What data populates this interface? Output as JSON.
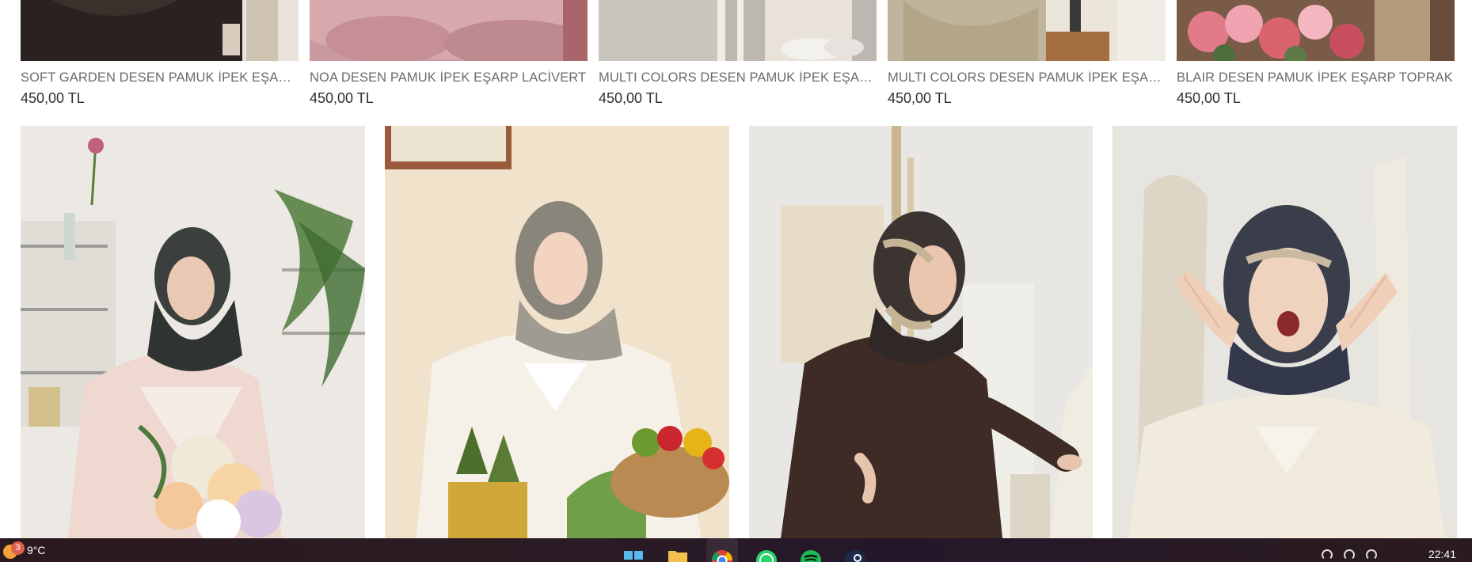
{
  "top_products": [
    {
      "name": "SOFT GARDEN DESEN PAMUK İPEK EŞARP...",
      "price": "450,00 TL"
    },
    {
      "name": "NOA DESEN PAMUK İPEK EŞARP LACİVERT",
      "price": "450,00 TL"
    },
    {
      "name": "MULTI COLORS DESEN PAMUK İPEK EŞARP...",
      "price": "450,00 TL"
    },
    {
      "name": "MULTI COLORS DESEN PAMUK İPEK EŞARP...",
      "price": "450,00 TL"
    },
    {
      "name": "BLAIR DESEN PAMUK İPEK EŞARP TOPRAK",
      "price": "450,00 TL"
    }
  ],
  "taskbar": {
    "weather_badge": "3",
    "temperature": "9°C",
    "apps": [
      "windows-start-icon",
      "file-explorer-icon",
      "chrome-icon",
      "whatsapp-icon",
      "spotify-icon",
      "steam-icon"
    ],
    "clock": "22:41"
  },
  "colors": {
    "text_muted": "#6b6b6b",
    "price": "#2f2f2f",
    "taskbar": "#2a1a1f"
  }
}
